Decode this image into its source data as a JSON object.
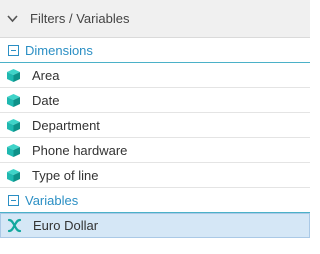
{
  "header": {
    "title": "Filters / Variables",
    "icon": "chevron-down-icon"
  },
  "dimensions": {
    "label": "Dimensions",
    "icon": "collapse-minus-icon",
    "items": [
      {
        "label": "Area",
        "icon": "cube-icon"
      },
      {
        "label": "Date",
        "icon": "cube-icon"
      },
      {
        "label": "Department",
        "icon": "cube-icon"
      },
      {
        "label": "Phone hardware",
        "icon": "cube-icon"
      },
      {
        "label": "Type of line",
        "icon": "cube-icon"
      }
    ]
  },
  "variables": {
    "label": "Variables",
    "icon": "collapse-minus-icon",
    "items": [
      {
        "label": "Euro Dollar",
        "icon": "variable-x-icon",
        "selected": true
      }
    ]
  },
  "colors": {
    "accent": "#2b8fc4",
    "cube": "#1fb8b0",
    "selected_bg": "#d5e7f6"
  }
}
